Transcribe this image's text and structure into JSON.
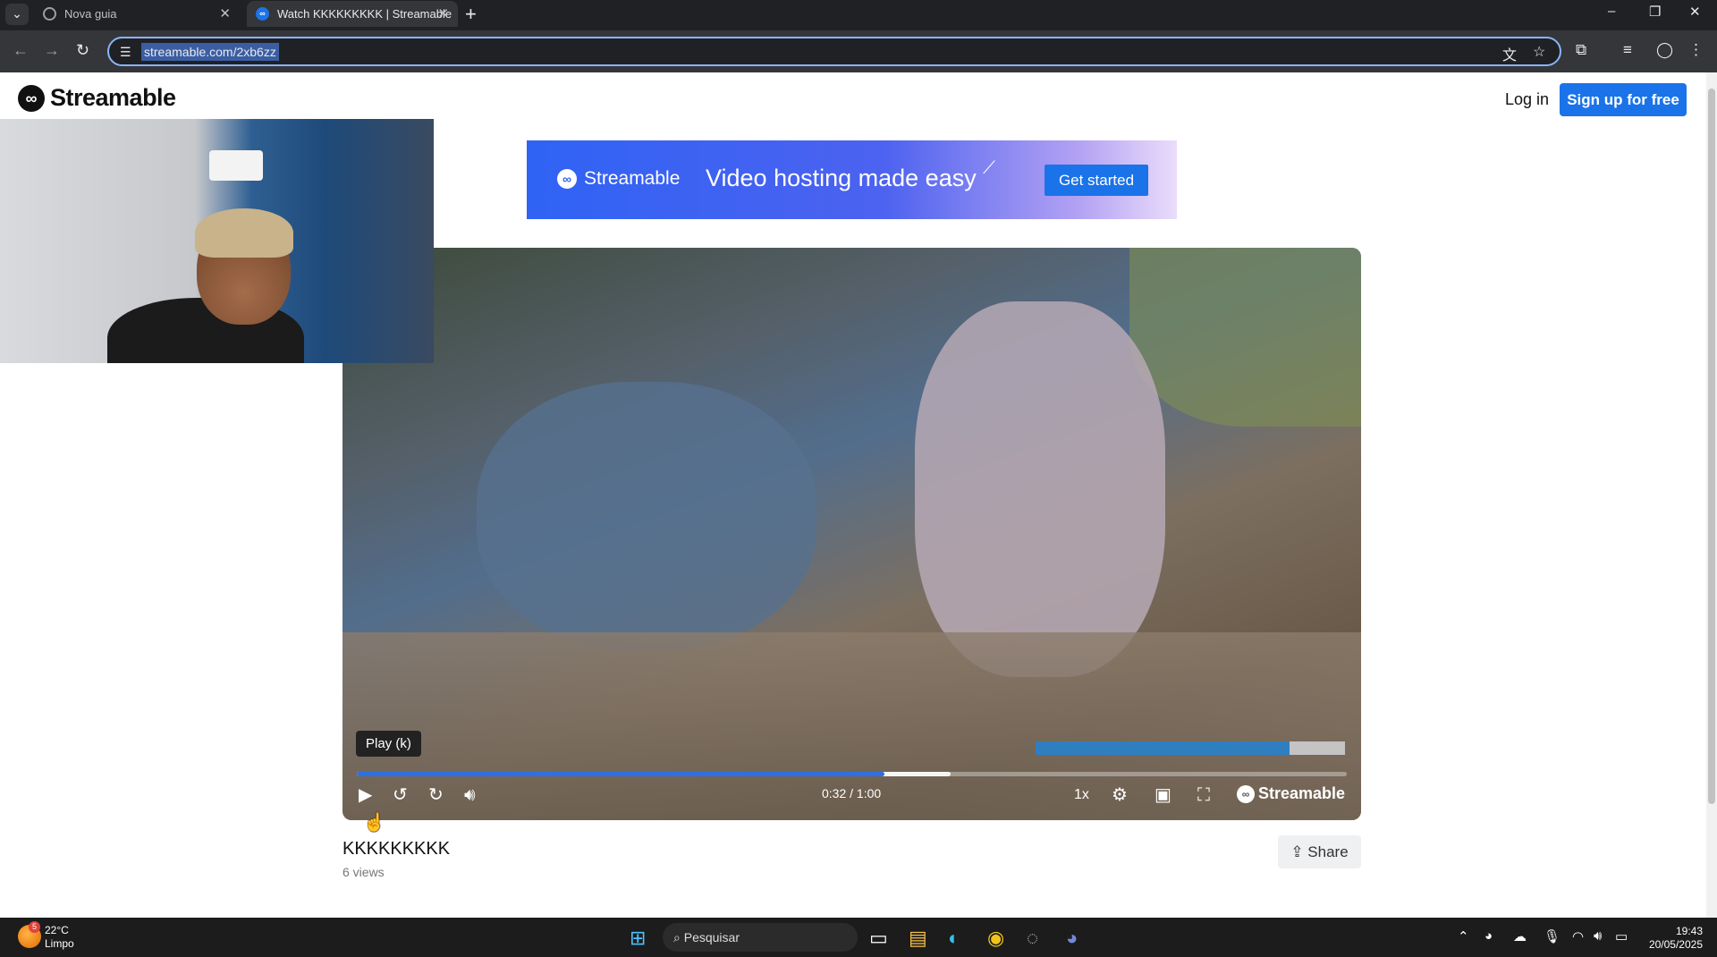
{
  "browser": {
    "tabs": [
      {
        "title": "Nova guia",
        "active": false
      },
      {
        "title": "Watch KKKKKKKKK | Streamable",
        "active": true
      }
    ],
    "new_tab": "+",
    "url": "streamable.com/2xb6zz",
    "window_controls": {
      "minimize": "–",
      "restore": "❐",
      "close": "✕"
    }
  },
  "site": {
    "logo_text": "Streamable",
    "login": "Log in",
    "signup": "Sign up for free"
  },
  "banner": {
    "brand": "Streamable",
    "tagline": "Video hosting made easy",
    "cta": "Get started"
  },
  "player": {
    "tooltip": "Play (k)",
    "time": "0:32 / 1:00",
    "progress_played": 0.533,
    "progress_buffered": 0.6,
    "speed": "1x",
    "watermark": "Streamable"
  },
  "video": {
    "title": "KKKKKKKKK",
    "views": "6 views",
    "share": "Share"
  },
  "taskbar": {
    "weather_temp": "22°C",
    "weather_desc": "Limpo",
    "weather_badge": "5",
    "search_placeholder": "Pesquisar",
    "time": "19:43",
    "date": "20/05/2025"
  },
  "colors": {
    "accent": "#1a73e8",
    "progress": "#2f6fe0",
    "chrome_dark": "#202124"
  }
}
